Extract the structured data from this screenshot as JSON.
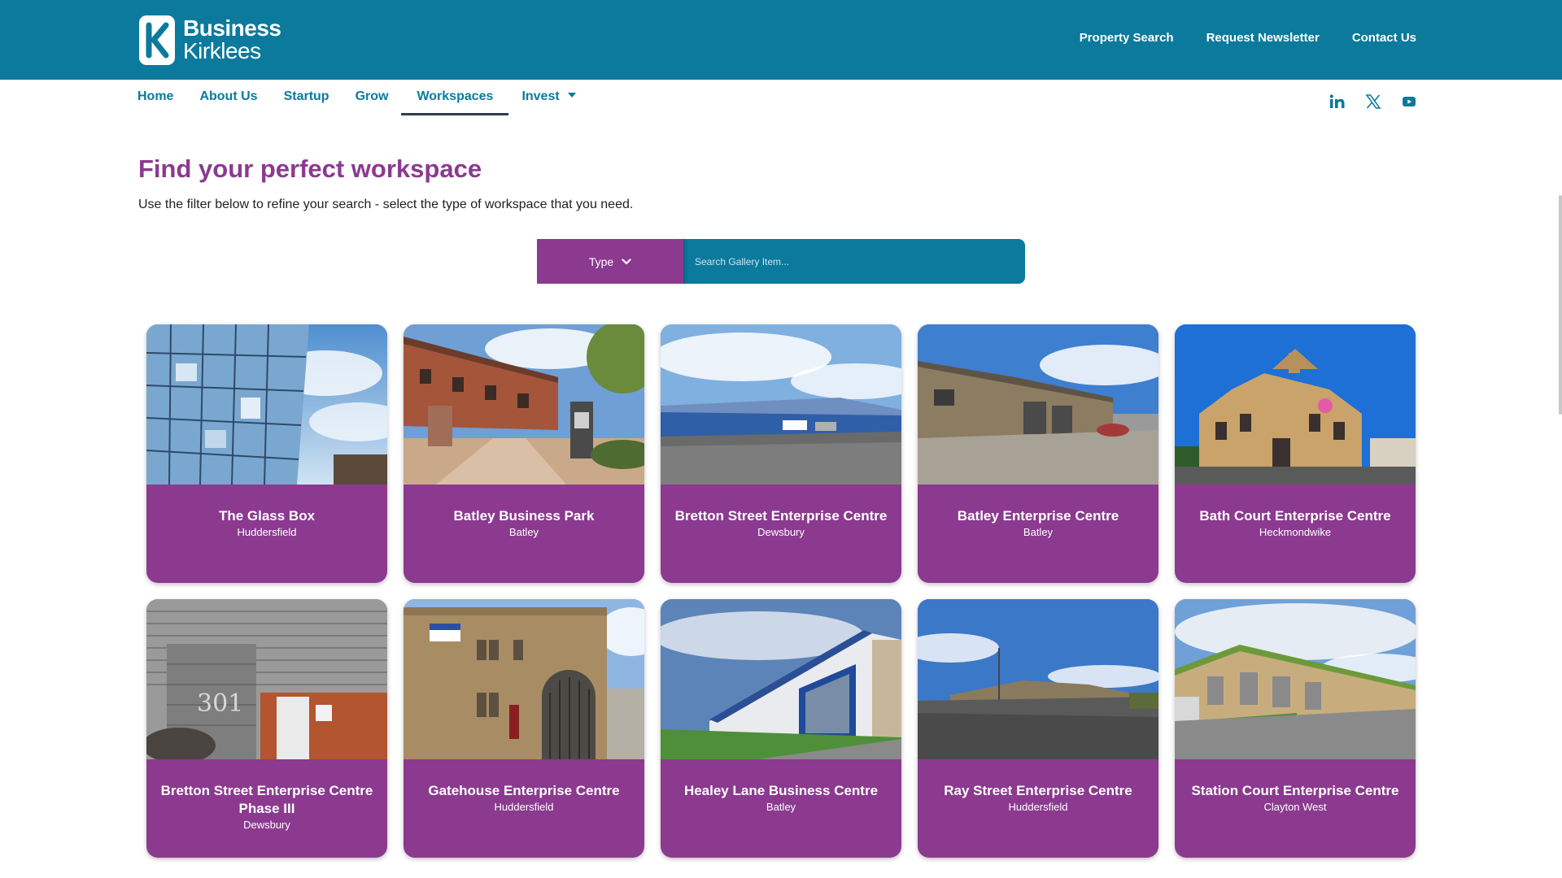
{
  "header": {
    "logo_line1": "Business",
    "logo_line2": "Kirklees",
    "links": [
      "Property Search",
      "Request Newsletter",
      "Contact Us"
    ]
  },
  "nav": {
    "items": [
      {
        "label": "Home"
      },
      {
        "label": "About Us"
      },
      {
        "label": "Startup"
      },
      {
        "label": "Grow"
      },
      {
        "label": "Workspaces",
        "active": true
      },
      {
        "label": "Invest",
        "dropdown": true
      }
    ]
  },
  "social": [
    "linkedin-icon",
    "x-twitter-icon",
    "youtube-icon"
  ],
  "main": {
    "title": "Find your perfect workspace",
    "intro": "Use the filter below to refine your search - select the type of workspace that you need.",
    "filter_label": "Type",
    "search_placeholder": "Search Gallery Item..."
  },
  "workspaces": [
    {
      "name": "The Glass Box",
      "location": "Huddersfield"
    },
    {
      "name": "Batley Business Park",
      "location": "Batley"
    },
    {
      "name": "Bretton Street Enterprise Centre",
      "location": "Dewsbury"
    },
    {
      "name": "Batley Enterprise Centre",
      "location": "Batley"
    },
    {
      "name": "Bath Court Enterprise Centre",
      "location": "Heckmondwike"
    },
    {
      "name": "Bretton Street Enterprise Centre Phase III",
      "location": "Dewsbury"
    },
    {
      "name": "Gatehouse Enterprise Centre",
      "location": "Huddersfield"
    },
    {
      "name": "Healey Lane Business Centre",
      "location": "Batley"
    },
    {
      "name": "Ray Street Enterprise Centre",
      "location": "Huddersfield"
    },
    {
      "name": "Station Court Enterprise Centre",
      "location": "Clayton West"
    }
  ],
  "colors": {
    "brand_teal": "#0b7a9c",
    "accent_purple": "#8b3a8f"
  }
}
